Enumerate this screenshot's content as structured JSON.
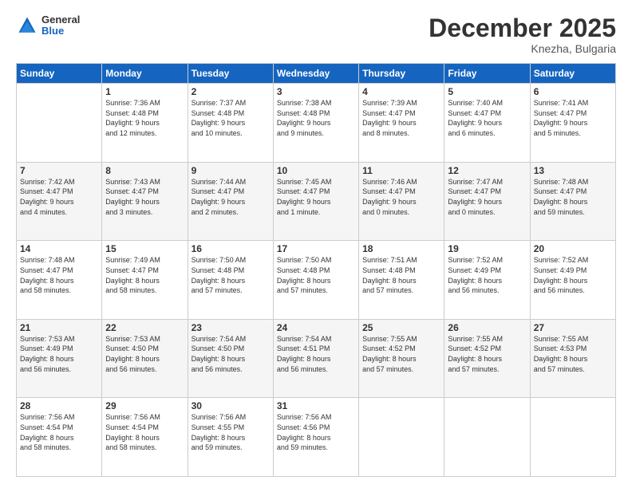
{
  "logo": {
    "general": "General",
    "blue": "Blue"
  },
  "header": {
    "month": "December 2025",
    "location": "Knezha, Bulgaria"
  },
  "weekdays": [
    "Sunday",
    "Monday",
    "Tuesday",
    "Wednesday",
    "Thursday",
    "Friday",
    "Saturday"
  ],
  "weeks": [
    [
      {
        "day": "",
        "info": ""
      },
      {
        "day": "1",
        "info": "Sunrise: 7:36 AM\nSunset: 4:48 PM\nDaylight: 9 hours\nand 12 minutes."
      },
      {
        "day": "2",
        "info": "Sunrise: 7:37 AM\nSunset: 4:48 PM\nDaylight: 9 hours\nand 10 minutes."
      },
      {
        "day": "3",
        "info": "Sunrise: 7:38 AM\nSunset: 4:48 PM\nDaylight: 9 hours\nand 9 minutes."
      },
      {
        "day": "4",
        "info": "Sunrise: 7:39 AM\nSunset: 4:47 PM\nDaylight: 9 hours\nand 8 minutes."
      },
      {
        "day": "5",
        "info": "Sunrise: 7:40 AM\nSunset: 4:47 PM\nDaylight: 9 hours\nand 6 minutes."
      },
      {
        "day": "6",
        "info": "Sunrise: 7:41 AM\nSunset: 4:47 PM\nDaylight: 9 hours\nand 5 minutes."
      }
    ],
    [
      {
        "day": "7",
        "info": "Sunrise: 7:42 AM\nSunset: 4:47 PM\nDaylight: 9 hours\nand 4 minutes."
      },
      {
        "day": "8",
        "info": "Sunrise: 7:43 AM\nSunset: 4:47 PM\nDaylight: 9 hours\nand 3 minutes."
      },
      {
        "day": "9",
        "info": "Sunrise: 7:44 AM\nSunset: 4:47 PM\nDaylight: 9 hours\nand 2 minutes."
      },
      {
        "day": "10",
        "info": "Sunrise: 7:45 AM\nSunset: 4:47 PM\nDaylight: 9 hours\nand 1 minute."
      },
      {
        "day": "11",
        "info": "Sunrise: 7:46 AM\nSunset: 4:47 PM\nDaylight: 9 hours\nand 0 minutes."
      },
      {
        "day": "12",
        "info": "Sunrise: 7:47 AM\nSunset: 4:47 PM\nDaylight: 9 hours\nand 0 minutes."
      },
      {
        "day": "13",
        "info": "Sunrise: 7:48 AM\nSunset: 4:47 PM\nDaylight: 8 hours\nand 59 minutes."
      }
    ],
    [
      {
        "day": "14",
        "info": "Sunrise: 7:48 AM\nSunset: 4:47 PM\nDaylight: 8 hours\nand 58 minutes."
      },
      {
        "day": "15",
        "info": "Sunrise: 7:49 AM\nSunset: 4:47 PM\nDaylight: 8 hours\nand 58 minutes."
      },
      {
        "day": "16",
        "info": "Sunrise: 7:50 AM\nSunset: 4:48 PM\nDaylight: 8 hours\nand 57 minutes."
      },
      {
        "day": "17",
        "info": "Sunrise: 7:50 AM\nSunset: 4:48 PM\nDaylight: 8 hours\nand 57 minutes."
      },
      {
        "day": "18",
        "info": "Sunrise: 7:51 AM\nSunset: 4:48 PM\nDaylight: 8 hours\nand 57 minutes."
      },
      {
        "day": "19",
        "info": "Sunrise: 7:52 AM\nSunset: 4:49 PM\nDaylight: 8 hours\nand 56 minutes."
      },
      {
        "day": "20",
        "info": "Sunrise: 7:52 AM\nSunset: 4:49 PM\nDaylight: 8 hours\nand 56 minutes."
      }
    ],
    [
      {
        "day": "21",
        "info": "Sunrise: 7:53 AM\nSunset: 4:49 PM\nDaylight: 8 hours\nand 56 minutes."
      },
      {
        "day": "22",
        "info": "Sunrise: 7:53 AM\nSunset: 4:50 PM\nDaylight: 8 hours\nand 56 minutes."
      },
      {
        "day": "23",
        "info": "Sunrise: 7:54 AM\nSunset: 4:50 PM\nDaylight: 8 hours\nand 56 minutes."
      },
      {
        "day": "24",
        "info": "Sunrise: 7:54 AM\nSunset: 4:51 PM\nDaylight: 8 hours\nand 56 minutes."
      },
      {
        "day": "25",
        "info": "Sunrise: 7:55 AM\nSunset: 4:52 PM\nDaylight: 8 hours\nand 57 minutes."
      },
      {
        "day": "26",
        "info": "Sunrise: 7:55 AM\nSunset: 4:52 PM\nDaylight: 8 hours\nand 57 minutes."
      },
      {
        "day": "27",
        "info": "Sunrise: 7:55 AM\nSunset: 4:53 PM\nDaylight: 8 hours\nand 57 minutes."
      }
    ],
    [
      {
        "day": "28",
        "info": "Sunrise: 7:56 AM\nSunset: 4:54 PM\nDaylight: 8 hours\nand 58 minutes."
      },
      {
        "day": "29",
        "info": "Sunrise: 7:56 AM\nSunset: 4:54 PM\nDaylight: 8 hours\nand 58 minutes."
      },
      {
        "day": "30",
        "info": "Sunrise: 7:56 AM\nSunset: 4:55 PM\nDaylight: 8 hours\nand 59 minutes."
      },
      {
        "day": "31",
        "info": "Sunrise: 7:56 AM\nSunset: 4:56 PM\nDaylight: 8 hours\nand 59 minutes."
      },
      {
        "day": "",
        "info": ""
      },
      {
        "day": "",
        "info": ""
      },
      {
        "day": "",
        "info": ""
      }
    ]
  ]
}
